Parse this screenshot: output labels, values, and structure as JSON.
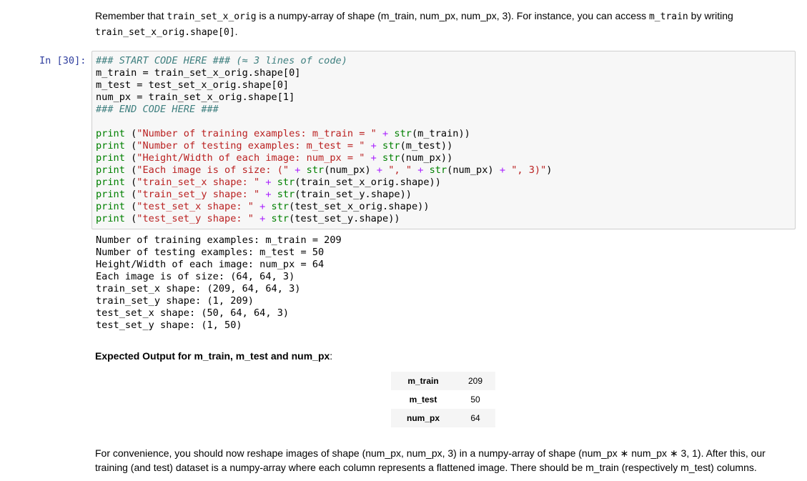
{
  "intro": {
    "t1": "Remember that ",
    "c1": "train_set_x_orig",
    "t2": " is a numpy-array of shape (m_train, num_px, num_px, 3). For instance, you can access ",
    "c2": "m_train",
    "t3": " by writing",
    "c3": "train_set_x_orig.shape[0]",
    "t4": "."
  },
  "cell": {
    "prompt": "In [30]:",
    "code_lines": [
      "### START CODE HERE ### (≈ 3 lines of code)",
      "m_train = train_set_x_orig.shape[0]",
      "m_test = test_set_x_orig.shape[0]",
      "num_px = train_set_x_orig.shape[1]",
      "### END CODE HERE ###",
      "",
      "print (\"Number of training examples: m_train = \" + str(m_train))",
      "print (\"Number of testing examples: m_test = \" + str(m_test))",
      "print (\"Height/Width of each image: num_px = \" + str(num_px))",
      "print (\"Each image is of size: (\" + str(num_px) + \", \" + str(num_px) + \", 3)\")",
      "print (\"train_set_x shape: \" + str(train_set_x_orig.shape))",
      "print (\"train_set_y shape: \" + str(train_set_y.shape))",
      "print (\"test_set_x shape: \" + str(test_set_x_orig.shape))",
      "print (\"test_set_y shape: \" + str(test_set_y.shape))"
    ],
    "output_lines": [
      "Number of training examples: m_train = 209",
      "Number of testing examples: m_test = 50",
      "Height/Width of each image: num_px = 64",
      "Each image is of size: (64, 64, 3)",
      "train_set_x shape: (209, 64, 64, 3)",
      "train_set_y shape: (1, 209)",
      "test_set_x shape: (50, 64, 64, 3)",
      "test_set_y shape: (1, 50)"
    ]
  },
  "expected": {
    "heading": "Expected Output for m_train, m_test and num_px",
    "colon": ":",
    "rows": [
      {
        "key": "m_train",
        "value": "209"
      },
      {
        "key": "m_test",
        "value": "50"
      },
      {
        "key": "num_px",
        "value": "64"
      }
    ]
  },
  "convenience": {
    "text": "For convenience, you should now reshape images of shape (num_px, num_px, 3) in a numpy-array of shape (num_px ∗ num_px ∗ 3, 1). After this, our training (and test) dataset is a numpy-array where each column represents a flattened image. There should be m_train (respectively m_test) columns."
  }
}
